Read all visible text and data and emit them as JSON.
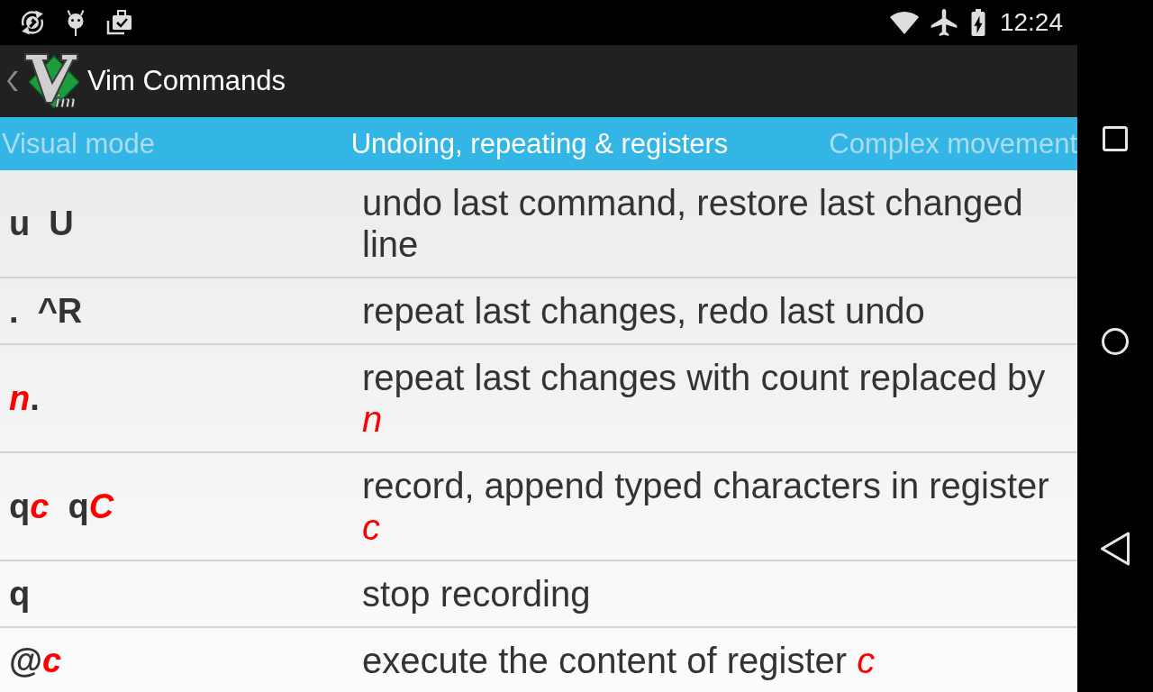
{
  "status_bar": {
    "time": "12:24"
  },
  "app_bar": {
    "logo_text": "im",
    "title": "Vim Commands"
  },
  "tabs": [
    {
      "label": "Visual mode",
      "selected": false
    },
    {
      "label": "Undoing, repeating & registers",
      "selected": true
    },
    {
      "label": "Complex movement",
      "selected": false
    }
  ],
  "commands": [
    {
      "keys": [
        {
          "text": "u  U",
          "variable": false
        }
      ],
      "description": "undo last command, restore last changed line"
    },
    {
      "keys": [
        {
          "text": ".  ^R",
          "variable": false
        }
      ],
      "description": "repeat last changes, redo last undo"
    },
    {
      "keys": [
        {
          "text": "n",
          "variable": true
        },
        {
          "text": ".",
          "variable": false
        }
      ],
      "description": "repeat last changes with count replaced by *n*"
    },
    {
      "keys": [
        {
          "text": "q",
          "variable": false
        },
        {
          "text": "c",
          "variable": true
        },
        {
          "text": "  q",
          "variable": false
        },
        {
          "text": "C",
          "variable": true
        }
      ],
      "description": "record, append typed characters in register *c*"
    },
    {
      "keys": [
        {
          "text": "q",
          "variable": false
        }
      ],
      "description": "stop recording"
    },
    {
      "keys": [
        {
          "text": "@",
          "variable": false
        },
        {
          "text": "c",
          "variable": true
        }
      ],
      "description": "execute the content of register *c*"
    }
  ]
}
